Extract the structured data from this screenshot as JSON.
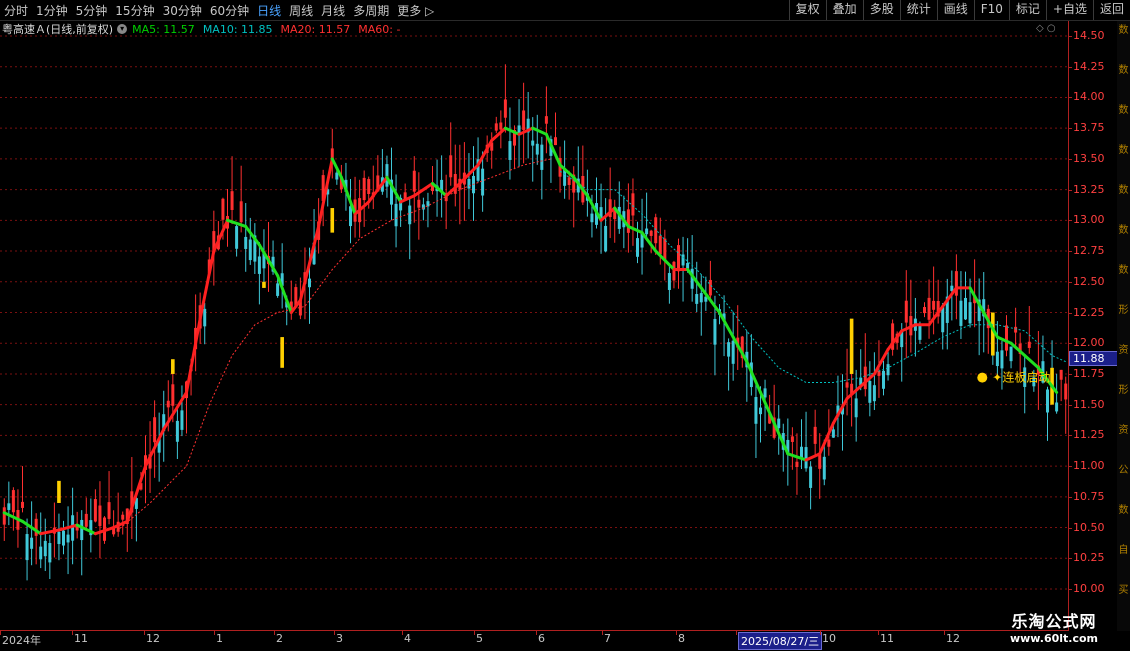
{
  "toolbar": {
    "periods": [
      "分时",
      "1分钟",
      "5分钟",
      "15分钟",
      "30分钟",
      "60分钟",
      "日线",
      "周线",
      "月线",
      "多周期",
      "更多"
    ],
    "active_period": "日线",
    "right_buttons": [
      "复权",
      "叠加",
      "多股",
      "统计",
      "画线",
      "F10",
      "标记",
      "+自选",
      "返回"
    ]
  },
  "info": {
    "stock": "粤高速Ａ(日线,前复权)",
    "ma5": "MA5: 11.57",
    "ma10": "MA10: 11.85",
    "ma20": "MA20: 11.57",
    "ma60": "MA60: -"
  },
  "colors": {
    "ma5": "#00d000",
    "ma10": "#00c0c0",
    "ma20": "#ff3030",
    "ma60": "#ff3030",
    "up": "#ff3030",
    "down": "#40c8d8",
    "signal": "#ffd000",
    "grid": "#7a1010"
  },
  "price_axis": {
    "ticks": [
      "14.50",
      "14.25",
      "14.00",
      "13.75",
      "13.50",
      "13.25",
      "13.00",
      "12.75",
      "12.50",
      "12.25",
      "12.00",
      "11.75",
      "11.50",
      "11.25",
      "11.00",
      "10.75",
      "10.50",
      "10.25",
      "10.00"
    ],
    "current_price": "11.88"
  },
  "side_strip": [
    "数",
    "数",
    "数",
    "数",
    "数",
    "数",
    "数",
    "形",
    "资",
    "形",
    "资",
    "公",
    "数",
    "自",
    "买"
  ],
  "date_axis": [
    {
      "label": "2024年"
    },
    {
      "label": "11"
    },
    {
      "label": "12"
    },
    {
      "label": "1"
    },
    {
      "label": "2"
    },
    {
      "label": "3"
    },
    {
      "label": "4"
    },
    {
      "label": "5"
    },
    {
      "label": "6"
    },
    {
      "label": "7"
    },
    {
      "label": "8"
    },
    {
      "label": "2025/08/27/三",
      "highlight": true
    },
    {
      "label": "10"
    },
    {
      "label": "11"
    },
    {
      "label": "12"
    }
  ],
  "annotation": {
    "text": "连板启动"
  },
  "watermark": {
    "line1": "乐淘公式网",
    "line2": "www.60lt.com"
  },
  "chart_data": {
    "type": "candlestick",
    "title": "粤高速Ａ(日线,前复权)",
    "ylim": [
      10.0,
      14.5
    ],
    "ma5_path": [
      [
        0,
        10.62
      ],
      [
        4,
        10.55
      ],
      [
        8,
        10.45
      ],
      [
        12,
        10.48
      ],
      [
        16,
        10.52
      ],
      [
        20,
        10.45
      ],
      [
        24,
        10.5
      ],
      [
        27,
        10.55
      ],
      [
        31,
        11.0
      ],
      [
        35,
        11.3
      ],
      [
        40,
        11.6
      ],
      [
        43,
        12.2
      ],
      [
        46,
        12.75
      ],
      [
        49,
        13.0
      ],
      [
        53,
        12.95
      ],
      [
        56,
        12.8
      ],
      [
        60,
        12.55
      ],
      [
        63,
        12.25
      ],
      [
        65,
        12.35
      ],
      [
        69,
        12.95
      ],
      [
        72,
        13.5
      ],
      [
        74,
        13.35
      ],
      [
        77,
        13.05
      ],
      [
        80,
        13.15
      ],
      [
        84,
        13.35
      ],
      [
        87,
        13.15
      ],
      [
        90,
        13.2
      ],
      [
        94,
        13.3
      ],
      [
        97,
        13.2
      ],
      [
        100,
        13.3
      ],
      [
        104,
        13.45
      ],
      [
        107,
        13.65
      ],
      [
        110,
        13.75
      ],
      [
        113,
        13.7
      ],
      [
        116,
        13.75
      ],
      [
        119,
        13.7
      ],
      [
        122,
        13.45
      ],
      [
        125,
        13.35
      ],
      [
        128,
        13.2
      ],
      [
        131,
        13.0
      ],
      [
        134,
        13.1
      ],
      [
        137,
        12.95
      ],
      [
        140,
        12.9
      ],
      [
        143,
        12.75
      ],
      [
        147,
        12.6
      ],
      [
        150,
        12.6
      ],
      [
        153,
        12.45
      ],
      [
        157,
        12.25
      ],
      [
        160,
        12.05
      ],
      [
        163,
        11.85
      ],
      [
        166,
        11.6
      ],
      [
        169,
        11.35
      ],
      [
        172,
        11.1
      ],
      [
        176,
        11.05
      ],
      [
        179,
        11.1
      ],
      [
        182,
        11.35
      ],
      [
        185,
        11.55
      ],
      [
        188,
        11.65
      ],
      [
        191,
        11.75
      ],
      [
        194,
        11.95
      ],
      [
        197,
        12.1
      ],
      [
        200,
        12.15
      ],
      [
        203,
        12.15
      ],
      [
        206,
        12.3
      ],
      [
        209,
        12.45
      ],
      [
        212,
        12.45
      ],
      [
        215,
        12.25
      ],
      [
        218,
        12.05
      ],
      [
        221,
        12.0
      ],
      [
        224,
        11.9
      ],
      [
        227,
        11.8
      ],
      [
        230,
        11.65
      ],
      [
        231,
        11.6
      ]
    ],
    "ma10_path": [
      [
        122,
        13.4
      ],
      [
        128,
        13.25
      ],
      [
        134,
        13.25
      ],
      [
        140,
        13.05
      ],
      [
        146,
        12.8
      ],
      [
        152,
        12.6
      ],
      [
        158,
        12.35
      ],
      [
        164,
        12.05
      ],
      [
        170,
        11.8
      ],
      [
        176,
        11.68
      ],
      [
        182,
        11.68
      ],
      [
        188,
        11.72
      ],
      [
        194,
        11.8
      ],
      [
        200,
        11.92
      ],
      [
        206,
        12.05
      ],
      [
        212,
        12.15
      ],
      [
        218,
        12.15
      ],
      [
        224,
        12.1
      ],
      [
        230,
        11.9
      ],
      [
        233,
        11.85
      ]
    ],
    "ma20_path": [
      [
        24,
        10.45
      ],
      [
        32,
        10.7
      ],
      [
        40,
        11.0
      ],
      [
        45,
        11.5
      ],
      [
        50,
        11.9
      ],
      [
        55,
        12.15
      ],
      [
        60,
        12.25
      ],
      [
        66,
        12.3
      ],
      [
        72,
        12.6
      ],
      [
        78,
        12.85
      ],
      [
        85,
        13.0
      ],
      [
        92,
        13.1
      ],
      [
        100,
        13.25
      ],
      [
        107,
        13.35
      ],
      [
        114,
        13.45
      ],
      [
        120,
        13.5
      ]
    ],
    "signal_bars": [
      [
        12,
        10.7,
        10.88
      ],
      [
        37,
        11.75,
        11.87
      ],
      [
        57,
        12.45,
        12.5
      ],
      [
        61,
        11.8,
        12.05
      ],
      [
        72,
        12.9,
        13.1
      ],
      [
        186,
        11.75,
        12.2
      ],
      [
        217,
        11.9,
        12.25
      ],
      [
        230,
        11.5,
        11.8
      ]
    ],
    "n_bars": 234
  }
}
